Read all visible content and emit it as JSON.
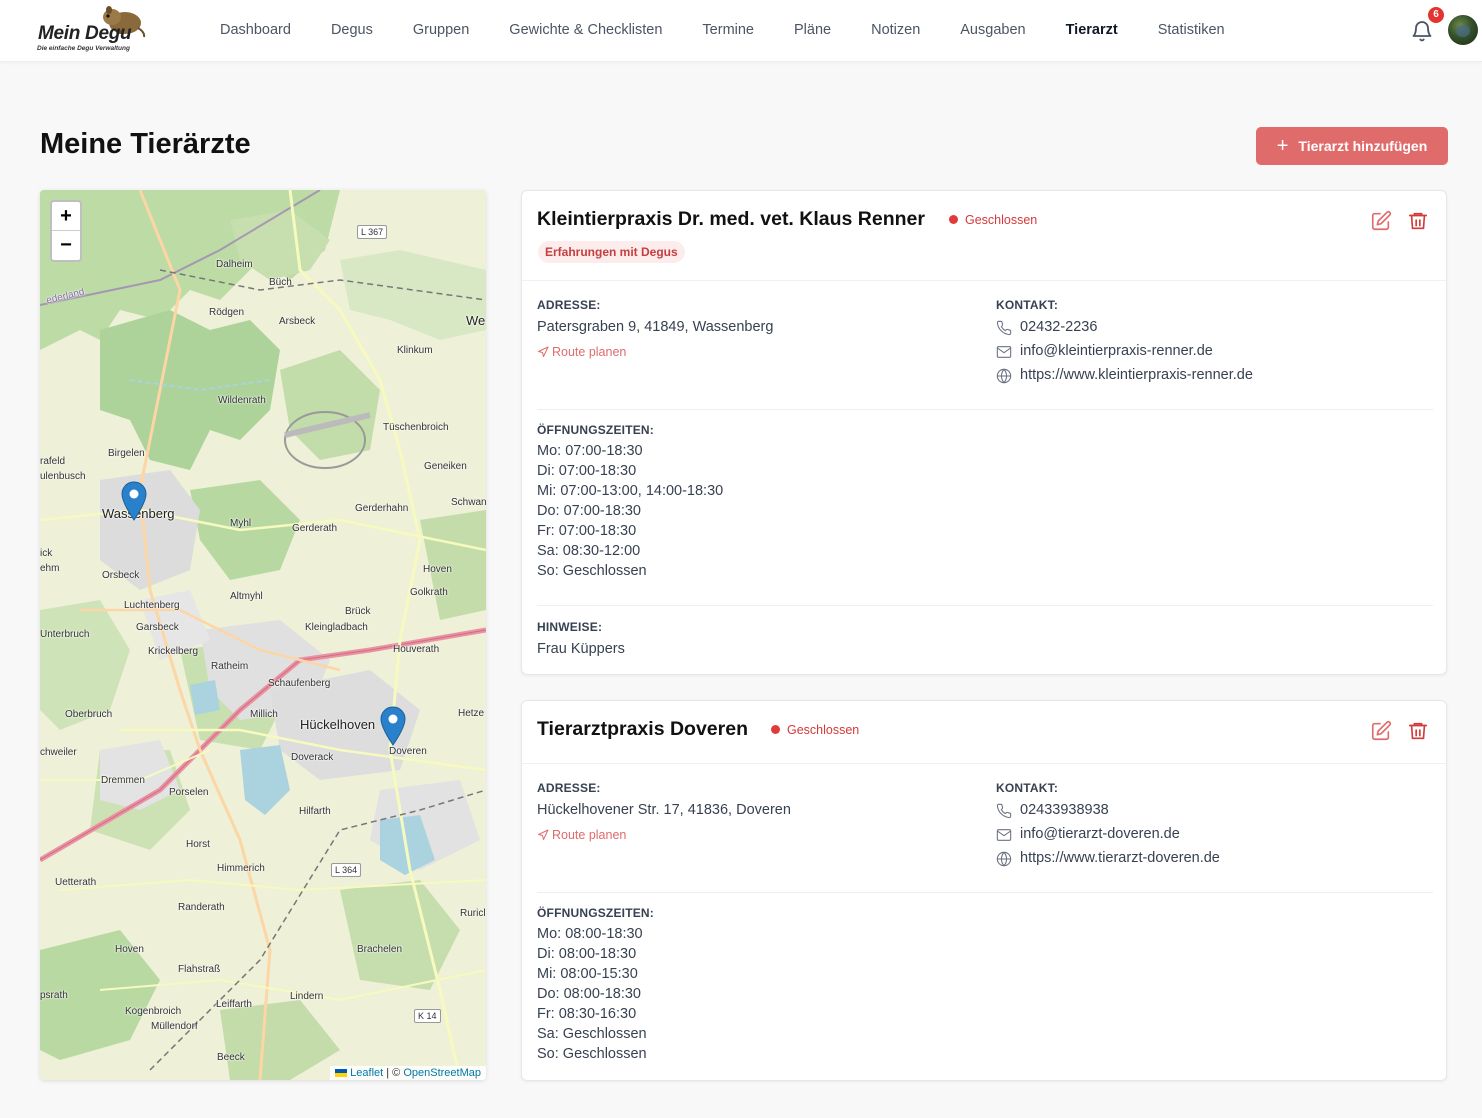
{
  "app": {
    "logo_title": "Mein Degu",
    "logo_subtitle": "Die einfache Degu Verwaltung",
    "notifications_count": "6"
  },
  "nav": {
    "items": [
      "Dashboard",
      "Degus",
      "Gruppen",
      "Gewichte & Checklisten",
      "Termine",
      "Pläne",
      "Notizen",
      "Ausgaben",
      "Tierarzt",
      "Statistiken"
    ],
    "active": "Tierarzt"
  },
  "page": {
    "title": "Meine Tierärzte",
    "add_button_label": "Tierarzt hinzufügen"
  },
  "labels": {
    "address": "ADRESSE:",
    "contact": "KONTAKT:",
    "hours": "ÖFFNUNGSZEITEN:",
    "notes": "HINWEISE:",
    "route": "Route planen"
  },
  "map": {
    "zoom_in": "+",
    "zoom_out": "−",
    "attribution_leaflet": "Leaflet",
    "attribution_sep": " | © ",
    "attribution_osm": "OpenStreetMap",
    "places": [
      "Dalheim",
      "Büch",
      "Rödgen",
      "Arsbeck",
      "Klinkum",
      "Wildenrath",
      "Tüschenbroich",
      "Birgelen",
      "Geneiken",
      "rafeld",
      "ulenbusch",
      "Wassenberg",
      "Myhl",
      "Gerderath",
      "Gerderhahn",
      "Schwan",
      "Orsbeck",
      "Hoven",
      "Altmyhl",
      "Golkrath",
      "Luchtenberg",
      "Garsbeck",
      "Brück",
      "Kleingladbach",
      "Unterbruch",
      "Krickelberg",
      "Houverath",
      "Ratheim",
      "Schaufenberg",
      "Oberbruch",
      "Millich",
      "Hückelhoven",
      "Hetze",
      "chweiler",
      "Doveren",
      "Doverack",
      "Dremmen",
      "Porselen",
      "Hilfarth",
      "Horst",
      "Himmerich",
      "Uetterath",
      "Randerath",
      "Ruricl",
      "Hoven",
      "Brachelen",
      "Flahstraß",
      "psrath",
      "Leiffarth",
      "Lindern",
      "Kogenbroich",
      "Müllendorf",
      "Beeck",
      "We",
      "ehm",
      "ick",
      "ederland"
    ],
    "road_labels": [
      "L 367",
      "L 364",
      "K 14"
    ]
  },
  "vets": [
    {
      "name": "Kleintierpraxis Dr. med. vet. Klaus Renner",
      "status": "Geschlossen",
      "tag": "Erfahrungen mit Degus",
      "address": "Patersgraben 9, 41849, Wassenberg",
      "phone": "02432-2236",
      "email": "info@kleintierpraxis-renner.de",
      "website": "https://www.kleintierpraxis-renner.de",
      "hours": [
        "Mo: 07:00-18:30",
        "Di: 07:00-18:30",
        "Mi: 07:00-13:00, 14:00-18:30",
        "Do: 07:00-18:30",
        "Fr: 07:00-18:30",
        "Sa: 08:30-12:00",
        "So: Geschlossen"
      ],
      "notes": "Frau Küppers"
    },
    {
      "name": "Tierarztpraxis Doveren",
      "status": "Geschlossen",
      "address": "Hückelhovener Str. 17, 41836, Doveren",
      "phone": "02433938938",
      "email": "info@tierarzt-doveren.de",
      "website": "https://www.tierarzt-doveren.de",
      "hours": [
        "Mo: 08:00-18:30",
        "Di: 08:00-18:30",
        "Mi: 08:00-15:30",
        "Do: 08:00-18:30",
        "Fr: 08:30-16:30",
        "Sa: Geschlossen",
        "So: Geschlossen"
      ]
    }
  ],
  "colors": {
    "accent": "#e06b6b",
    "status_closed": "#e03b3b",
    "marker": "#2a81cb"
  }
}
